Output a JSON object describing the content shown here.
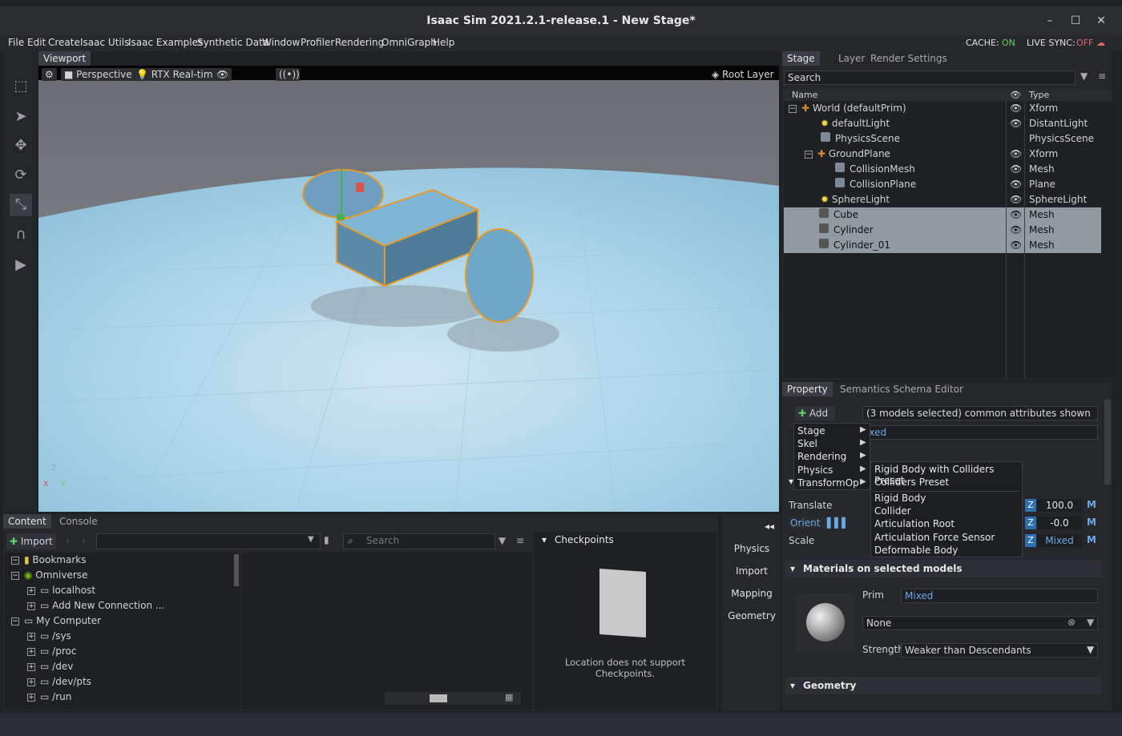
{
  "window": {
    "title": "Isaac Sim 2021.2.1-release.1 - New Stage*"
  },
  "menu": [
    "File",
    "Edit",
    "Create",
    "Isaac Utils",
    "Isaac Examples",
    "Synthetic Data",
    "Window",
    "Profiler",
    "Rendering",
    "OmniGraph",
    "Help"
  ],
  "status": {
    "cache_label": "CACHE:",
    "cache_value": "ON",
    "live_label": "LIVE SYNC:",
    "live_value": "OFF"
  },
  "viewport": {
    "tab": "Viewport",
    "camera": "Perspective",
    "renderer": "RTX Real-time",
    "layer": "Root Layer",
    "axes": {
      "z": "Z",
      "x": "X",
      "y": "Y"
    }
  },
  "stage": {
    "tabs": [
      "Stage",
      "Layer",
      "Render Settings"
    ],
    "search_placeholder": "Search",
    "columns": {
      "name": "Name",
      "type": "Type"
    },
    "rows": [
      {
        "name": "World (defaultPrim)",
        "type": "Xform"
      },
      {
        "name": "defaultLight",
        "type": "DistantLight"
      },
      {
        "name": "PhysicsScene",
        "type": "PhysicsScene"
      },
      {
        "name": "GroundPlane",
        "type": "Xform"
      },
      {
        "name": "CollisionMesh",
        "type": "Mesh"
      },
      {
        "name": "CollisionPlane",
        "type": "Plane"
      },
      {
        "name": "SphereLight",
        "type": "SphereLight"
      },
      {
        "name": "Cube",
        "type": "Mesh"
      },
      {
        "name": "Cylinder",
        "type": "Mesh"
      },
      {
        "name": "Cylinder_01",
        "type": "Mesh"
      }
    ]
  },
  "property": {
    "tabs": [
      "Property",
      "Semantics Schema Editor"
    ],
    "add_label": "Add",
    "selection_info": "(3 models selected) common attributes shown",
    "mixed_field": "ixed",
    "add_menu": [
      "Stage",
      "Skel",
      "Rendering",
      "Physics",
      "TransformOp"
    ],
    "physics_submenu": [
      "Rigid Body with Colliders Preset",
      "Colliders Preset",
      "Rigid Body",
      "Collider",
      "Articulation Root",
      "Articulation Force Sensor",
      "Deformable Body"
    ],
    "translate_label": "Translate",
    "orient_label": "Orient",
    "scale_label": "Scale",
    "z_label": "Z",
    "translate_z": "100.0",
    "orient_z": "-0.0",
    "scale_z": "Mixed",
    "m_label": "M",
    "materials_header": "Materials on selected models",
    "prim_label": "Prim",
    "prim_value": "Mixed",
    "material_value": "None",
    "strength_label": "Strength",
    "strength_value": "Weaker than Descendants",
    "geometry_header": "Geometry"
  },
  "content": {
    "tabs": [
      "Content",
      "Console"
    ],
    "import_label": "Import",
    "search_placeholder": "Search",
    "tree": [
      {
        "label": "Bookmarks",
        "level": 0
      },
      {
        "label": "Omniverse",
        "level": 0
      },
      {
        "label": "localhost",
        "level": 1
      },
      {
        "label": "Add New Connection ...",
        "level": 1
      },
      {
        "label": "My Computer",
        "level": 0
      },
      {
        "label": "/sys",
        "level": 1
      },
      {
        "label": "/proc",
        "level": 1
      },
      {
        "label": "/dev",
        "level": 1
      },
      {
        "label": "/dev/pts",
        "level": 1
      },
      {
        "label": "/run",
        "level": 1
      }
    ],
    "checkpoints_header": "Checkpoints",
    "checkpoints_msg": "Location does not support Checkpoints."
  },
  "side_buttons": [
    "Physics",
    "Import",
    "Mapping",
    "Geometry"
  ]
}
